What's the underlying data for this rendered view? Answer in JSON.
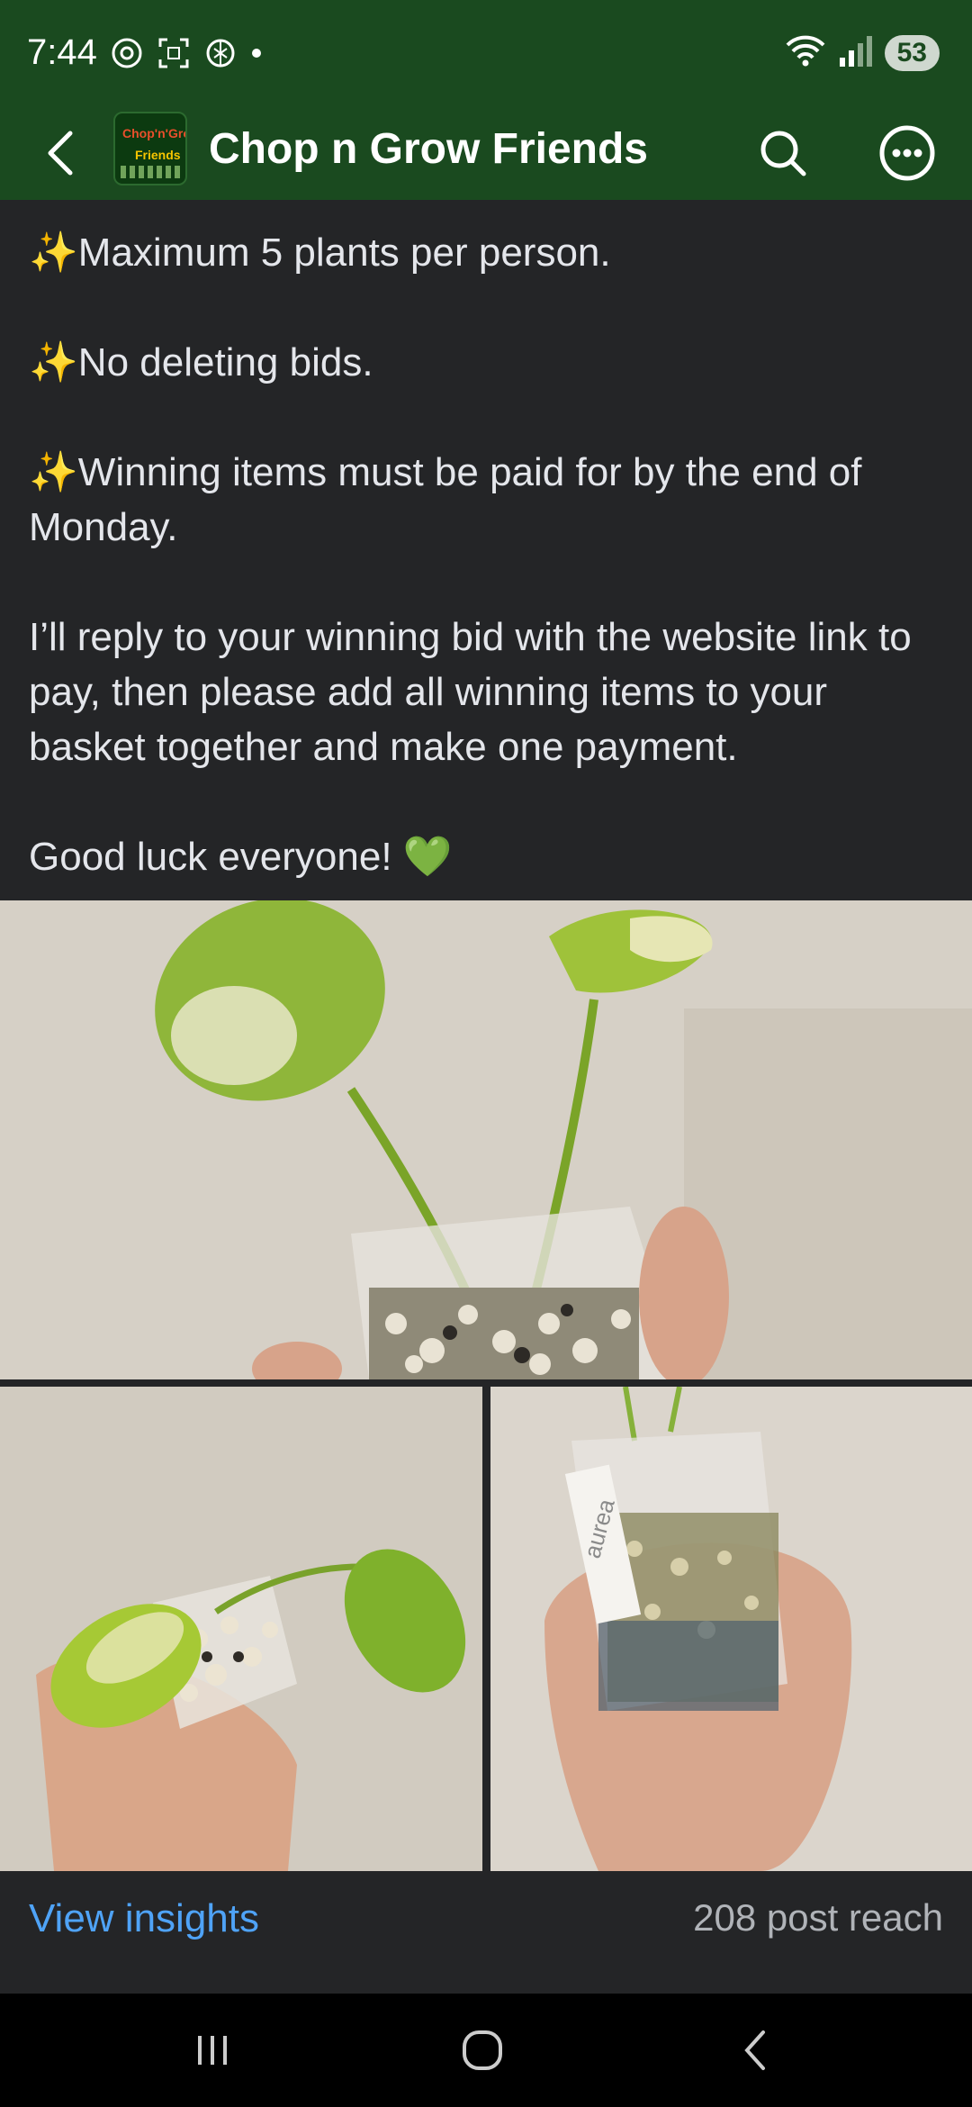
{
  "status_bar": {
    "time": "7:44",
    "battery": "53",
    "left_icons": [
      "threads-icon",
      "screenshot-icon",
      "chatgpt-icon",
      "dot-icon"
    ],
    "right_icons": [
      "wifi-icon",
      "signal-icon"
    ]
  },
  "header": {
    "title": "Chop n Grow Friends",
    "avatar_line1": "Chop'n'Grow",
    "avatar_line2": "Friends",
    "background": "#1a4a1f"
  },
  "post": {
    "lines": [
      {
        "sparkle": "✨",
        "text": "Maximum 5 plants per person."
      },
      {
        "sparkle": "✨",
        "text": "No deleting bids."
      },
      {
        "sparkle": "✨",
        "text": "Winning items must be paid for by the end of Monday."
      },
      {
        "sparkle": "",
        "text": "I’ll reply to your winning bid with the website link to pay, then please add all winning items to your basket together and make one payment."
      }
    ],
    "closing": "Good luck everyone!",
    "closing_emoji": "💚",
    "photo_label_text": "aurea"
  },
  "footer": {
    "view_insights": "View insights",
    "post_reach": "208 post reach",
    "link_color": "#4fa3f7"
  },
  "nav": {
    "icons": [
      "recents-icon",
      "home-icon",
      "back-nav-icon"
    ]
  }
}
